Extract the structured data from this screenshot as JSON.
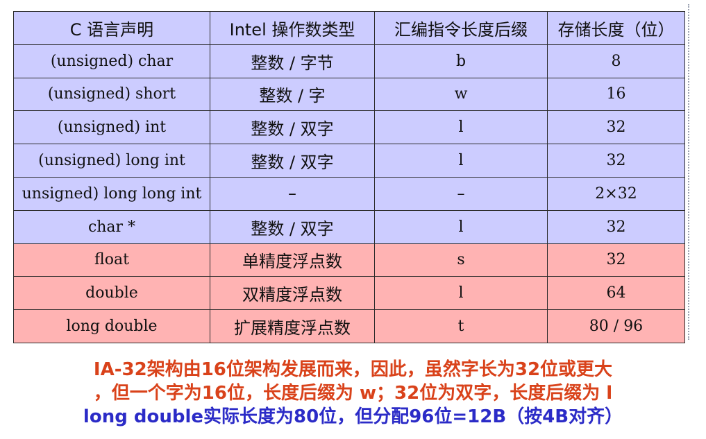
{
  "table": {
    "headers": [
      "C 语言声明",
      "Intel 操作数类型",
      "汇编指令长度后缀",
      "存储长度（位）"
    ],
    "rows": [
      {
        "c_decl": "(unsigned) char",
        "intel_type": "整数 / 字节",
        "suffix": "b",
        "bits": "8",
        "group": "int"
      },
      {
        "c_decl": "(unsigned) short",
        "intel_type": "整数 / 字",
        "suffix": "w",
        "bits": "16",
        "group": "int"
      },
      {
        "c_decl": "(unsigned) int",
        "intel_type": "整数 / 双字",
        "suffix": "l",
        "bits": "32",
        "group": "int"
      },
      {
        "c_decl": "(unsigned) long int",
        "intel_type": "整数 / 双字",
        "suffix": "l",
        "bits": "32",
        "group": "int"
      },
      {
        "c_decl": "unsigned) long long int",
        "intel_type": "–",
        "suffix": "–",
        "bits": "2×32",
        "group": "int"
      },
      {
        "c_decl": "char *",
        "intel_type": "整数 / 双字",
        "suffix": "l",
        "bits": "32",
        "group": "int"
      },
      {
        "c_decl": "float",
        "intel_type": "单精度浮点数",
        "suffix": "s",
        "bits": "32",
        "group": "float"
      },
      {
        "c_decl": "double",
        "intel_type": "双精度浮点数",
        "suffix": "l",
        "bits": "64",
        "group": "float"
      },
      {
        "c_decl": "long double",
        "intel_type": "扩展精度浮点数",
        "suffix": "t",
        "bits": "80 / 96",
        "group": "float"
      }
    ]
  },
  "caption": {
    "line1": "IA-32架构由16位架构发展而来，因此，虽然字长为32位或更大",
    "line2": "，但一个字为16位，长度后缀为 w；32位为双字，长度后缀为 l",
    "line3": "long double实际长度为80位，但分配96位=12B（按4B对齐）"
  },
  "colors": {
    "header_bg": "#ccccff",
    "int_row_bg": "#ccccff",
    "float_row_bg": "#ffb3b3",
    "caption_red": "#d9421a",
    "caption_blue": "#2b2bc7"
  }
}
